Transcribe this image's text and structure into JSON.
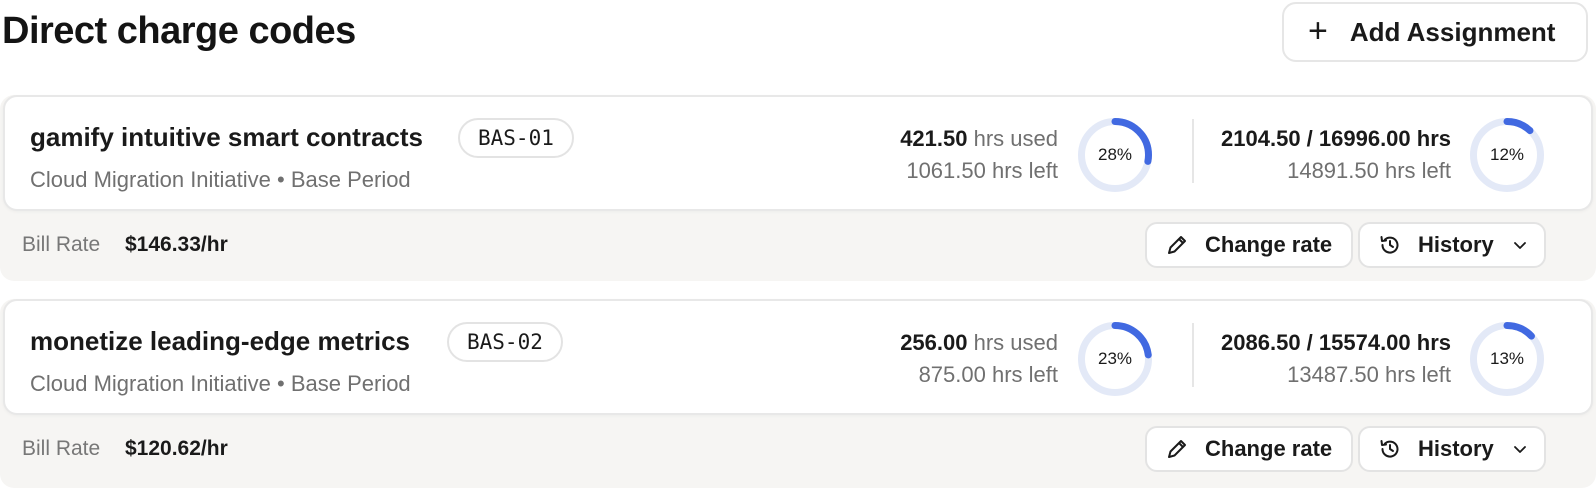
{
  "header": {
    "title": "Direct charge codes",
    "add_button_label": "Add Assignment",
    "add_icon": "+"
  },
  "colors": {
    "accent": "#4169e1",
    "ring_track": "#e3e9f7",
    "footer_bg": "#f6f5f3"
  },
  "assignments": [
    {
      "name": "gamify intuitive smart contracts",
      "code": "BAS-01",
      "subtitle": "Cloud Migration Initiative • Base Period",
      "used_value": "421.50",
      "used_suffix": "hrs used",
      "left_text": "1061.50 hrs left",
      "used_pct": 28,
      "used_pct_label": "28%",
      "total_text": "2104.50 / 16996.00 hrs",
      "total_left_text": "14891.50 hrs left",
      "total_pct": 12,
      "total_pct_label": "12%",
      "bill_rate_label": "Bill Rate",
      "bill_rate_value": "$146.33/hr",
      "change_rate_label": "Change rate",
      "history_label": "History"
    },
    {
      "name": "monetize leading-edge metrics",
      "code": "BAS-02",
      "subtitle": "Cloud Migration Initiative • Base Period",
      "used_value": "256.00",
      "used_suffix": "hrs used",
      "left_text": "875.00 hrs left",
      "used_pct": 23,
      "used_pct_label": "23%",
      "total_text": "2086.50 / 15574.00 hrs",
      "total_left_text": "13487.50 hrs left",
      "total_pct": 13,
      "total_pct_label": "13%",
      "bill_rate_label": "Bill Rate",
      "bill_rate_value": "$120.62/hr",
      "change_rate_label": "Change rate",
      "history_label": "History"
    }
  ]
}
